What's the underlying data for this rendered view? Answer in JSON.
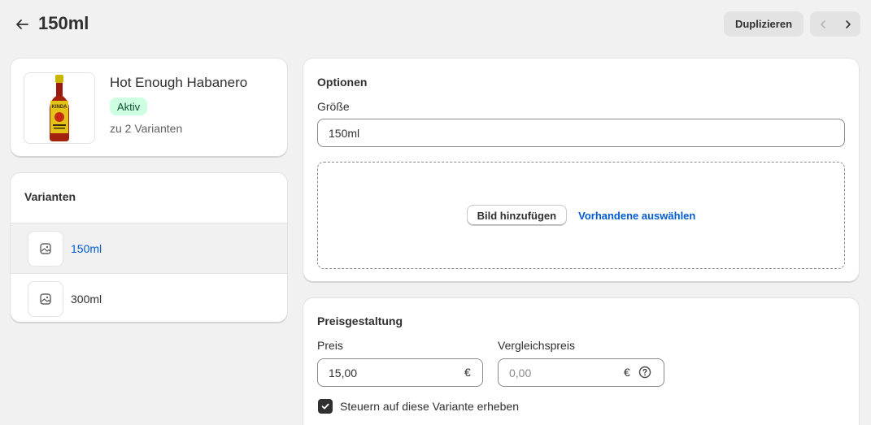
{
  "header": {
    "title": "150ml",
    "duplicate_label": "Duplizieren"
  },
  "product": {
    "name": "Hot Enough Habanero",
    "status": "Aktiv",
    "variant_count": "zu 2 Varianten",
    "bottle_text": "KINDA"
  },
  "variants": {
    "title": "Varianten",
    "items": [
      {
        "label": "150ml",
        "selected": true
      },
      {
        "label": "300ml",
        "selected": false
      }
    ]
  },
  "options": {
    "title": "Optionen",
    "size_label": "Größe",
    "size_value": "150ml",
    "add_image_label": "Bild hinzufügen",
    "select_existing_label": "Vorhandene auswählen"
  },
  "pricing": {
    "title": "Preisgestaltung",
    "price_label": "Preis",
    "price_value": "15,00",
    "price_currency": "€",
    "compare_label": "Vergleichspreis",
    "compare_placeholder": "0,00",
    "compare_currency": "€",
    "tax_label": "Steuern auf diese Variante erheben",
    "tax_checked": true
  },
  "colors": {
    "link": "#005bd3",
    "badge_bg": "#cdfee1",
    "badge_text": "#0c5132"
  }
}
